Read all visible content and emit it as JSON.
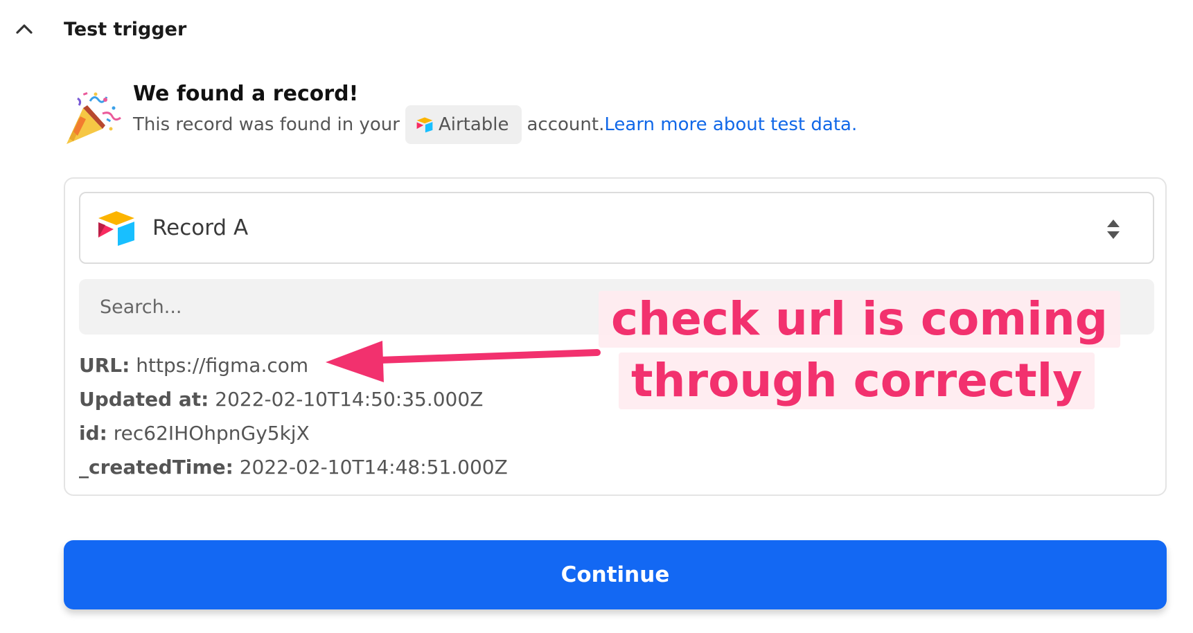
{
  "section": {
    "title": "Test trigger",
    "chevron_icon": "chevron-up-icon"
  },
  "result": {
    "icon": "party-popper-icon",
    "title": "We found a record!",
    "desc_before": "This record was found in your",
    "app_name": "Airtable",
    "desc_after": "account.",
    "learn_link": "Learn more about test data."
  },
  "record_select": {
    "selected": "Record A",
    "icon": "airtable-logo-icon"
  },
  "search": {
    "placeholder": "Search..."
  },
  "fields": [
    {
      "key": "URL:",
      "value": "https://figma.com"
    },
    {
      "key": "Updated at:",
      "value": "2022-02-10T14:50:35.000Z"
    },
    {
      "key": "id:",
      "value": "rec62IHOhpnGy5kjX"
    },
    {
      "key": "_createdTime:",
      "value": "2022-02-10T14:48:51.000Z"
    }
  ],
  "annotation": {
    "line1": "check url is coming",
    "line2": "through correctly",
    "color": "#f2316e"
  },
  "continue_label": "Continue",
  "colors": {
    "primary": "#1368f3",
    "link": "#1168e8"
  }
}
